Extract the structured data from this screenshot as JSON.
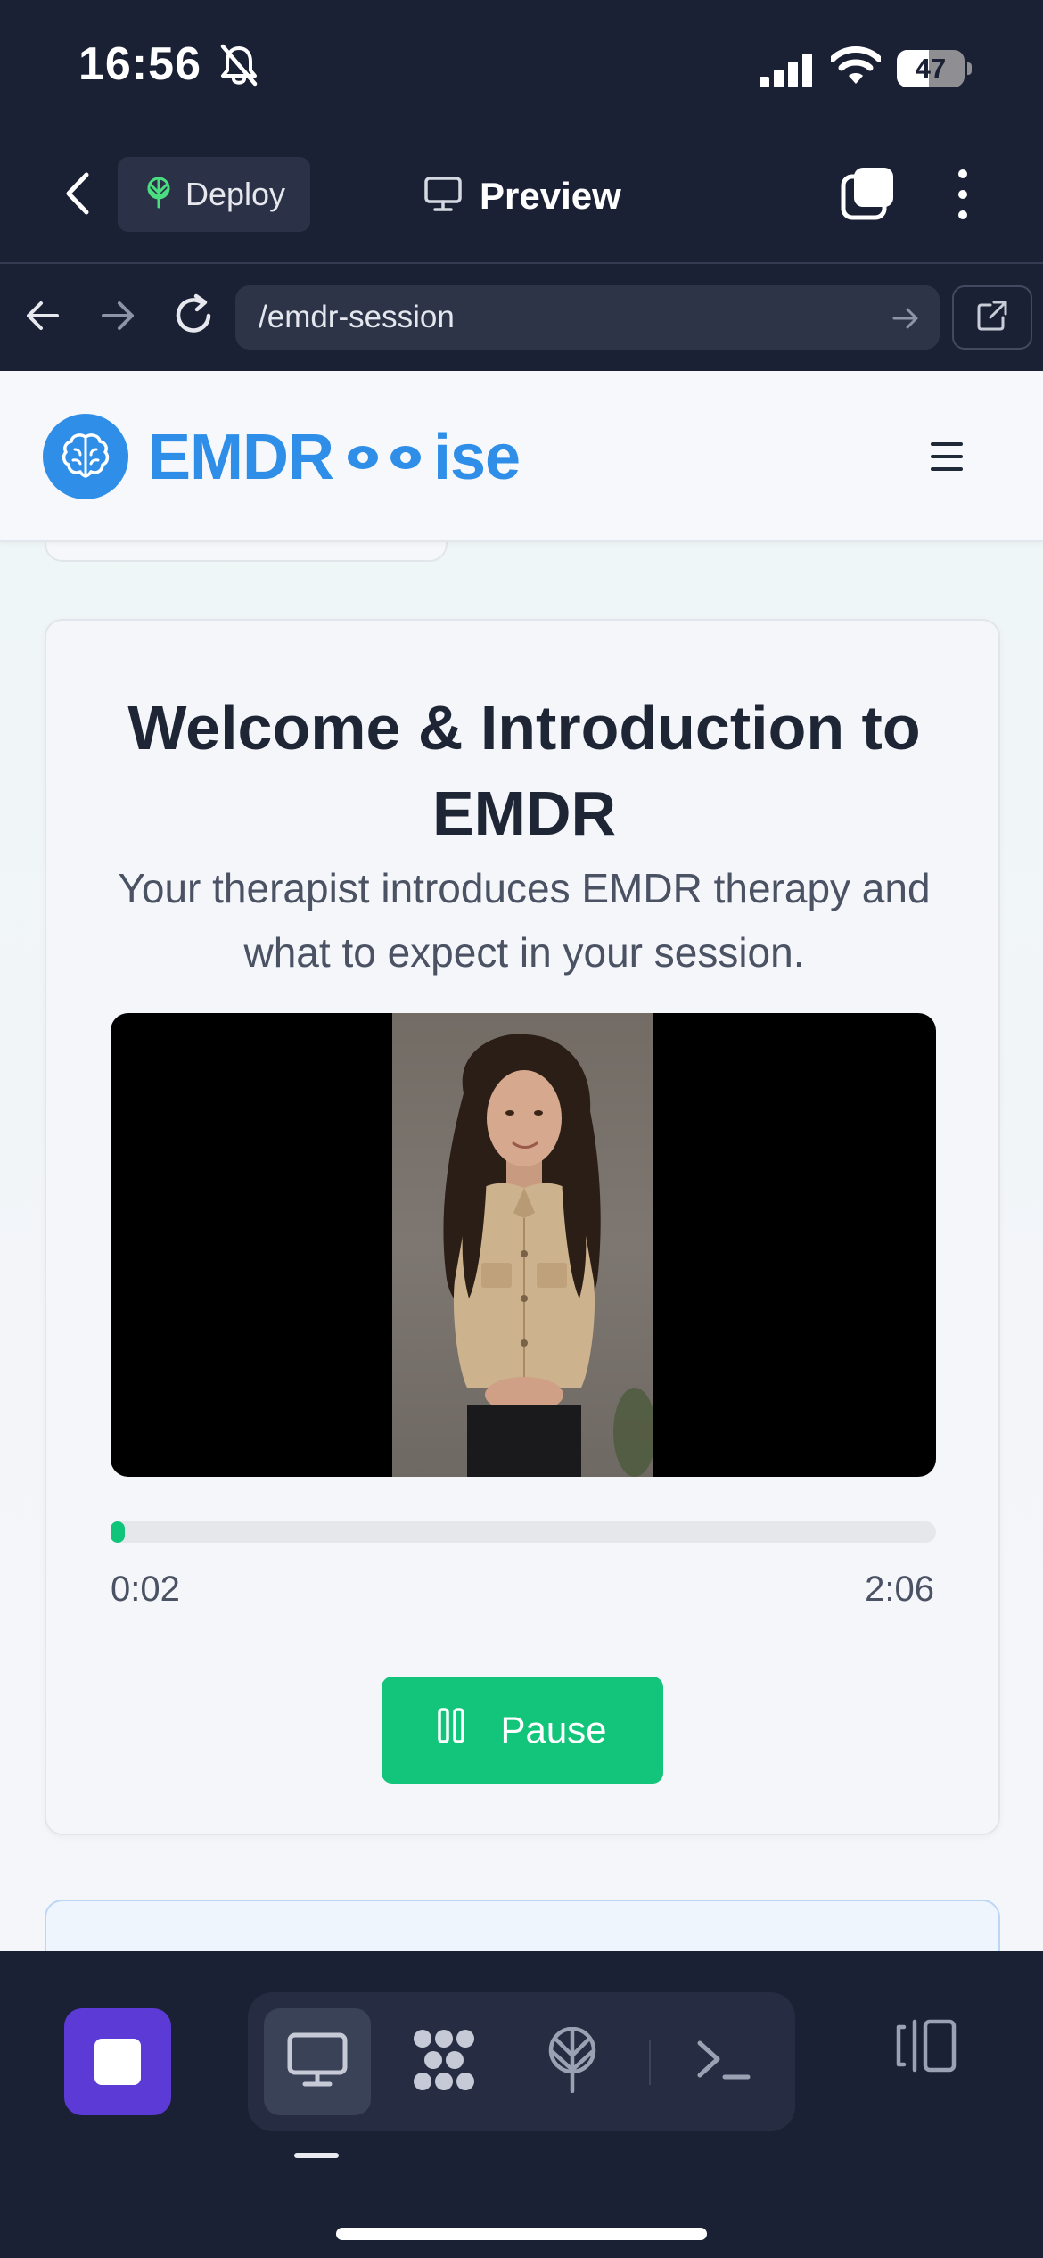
{
  "status_bar": {
    "time": "16:56",
    "battery_percent": "47",
    "battery_level": 0.47
  },
  "app_bar": {
    "deploy_label": "Deploy",
    "preview_label": "Preview"
  },
  "browser": {
    "url": "/emdr-session"
  },
  "site": {
    "logo_text_left": "EMDR",
    "logo_text_right": "ise",
    "brand_color": "#2f8fe8"
  },
  "session": {
    "title": "Welcome & Introduction to EMDR",
    "subtitle": "Your therapist introduces EMDR therapy and what to expect in your session.",
    "current_time": "0:02",
    "total_time": "2:06",
    "progress": 0.016,
    "pause_label": "Pause",
    "accent_color": "#12c57a"
  },
  "icons": {
    "status": [
      "bell-slash-icon",
      "cellular-signal-icon",
      "wifi-icon",
      "battery-icon"
    ],
    "app_bar": [
      "chevron-left-icon",
      "deploy-icon",
      "monitor-icon",
      "tabs-icon",
      "more-vertical-icon"
    ],
    "browser": [
      "arrow-left-icon",
      "arrow-right-icon",
      "reload-icon",
      "arrow-right-icon",
      "external-link-icon"
    ],
    "bottom_bar": [
      "stop-icon",
      "monitor-icon",
      "dots-grid-icon",
      "deploy-icon",
      "terminal-icon",
      "layout-icon"
    ]
  }
}
